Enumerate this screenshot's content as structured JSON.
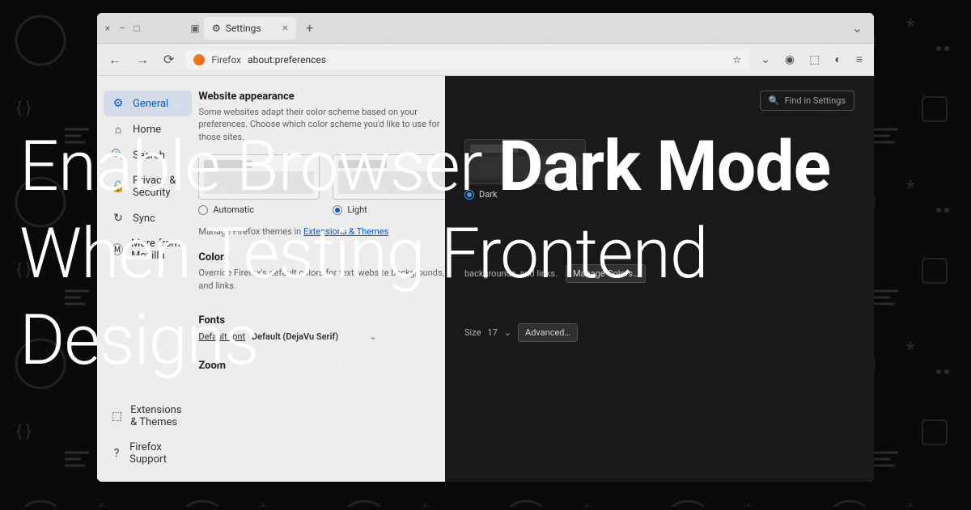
{
  "headline": {
    "part1": "Enable Browser ",
    "bold1": "Dark Mode",
    "part2": " When Testing Frontend Designs"
  },
  "titlebar": {
    "tab_label": "Settings"
  },
  "toolbar": {
    "product": "Firefox",
    "url": "about:preferences"
  },
  "sidebar": {
    "items": [
      {
        "label": "General"
      },
      {
        "label": "Home"
      },
      {
        "label": "Search"
      },
      {
        "label": "Privacy & Security"
      },
      {
        "label": "Sync"
      },
      {
        "label": "More from Mozilla"
      }
    ],
    "footer": [
      {
        "label": "Extensions & Themes"
      },
      {
        "label": "Firefox Support"
      }
    ]
  },
  "settings": {
    "find_placeholder": "Find in Settings",
    "appearance": {
      "heading": "Website appearance",
      "desc": "Some websites adapt their color scheme based on your preferences. Choose which color scheme you'd like to use for those sites.",
      "options": {
        "automatic": "Automatic",
        "light": "Light",
        "dark": "Dark"
      },
      "themes_prefix": "Manage Firefox themes in ",
      "themes_link": "Extensions & Themes"
    },
    "colors": {
      "heading": "Colors",
      "desc": "Override Firefox's default colors for text, website backgrounds, and links.",
      "button": "Manage Colors…"
    },
    "fonts": {
      "heading": "Fonts",
      "label": "Default font",
      "value": "Default (DejaVu Serif)",
      "size_label": "Size",
      "size_value": "17",
      "advanced": "Advanced…"
    },
    "zoom": {
      "heading": "Zoom"
    }
  }
}
